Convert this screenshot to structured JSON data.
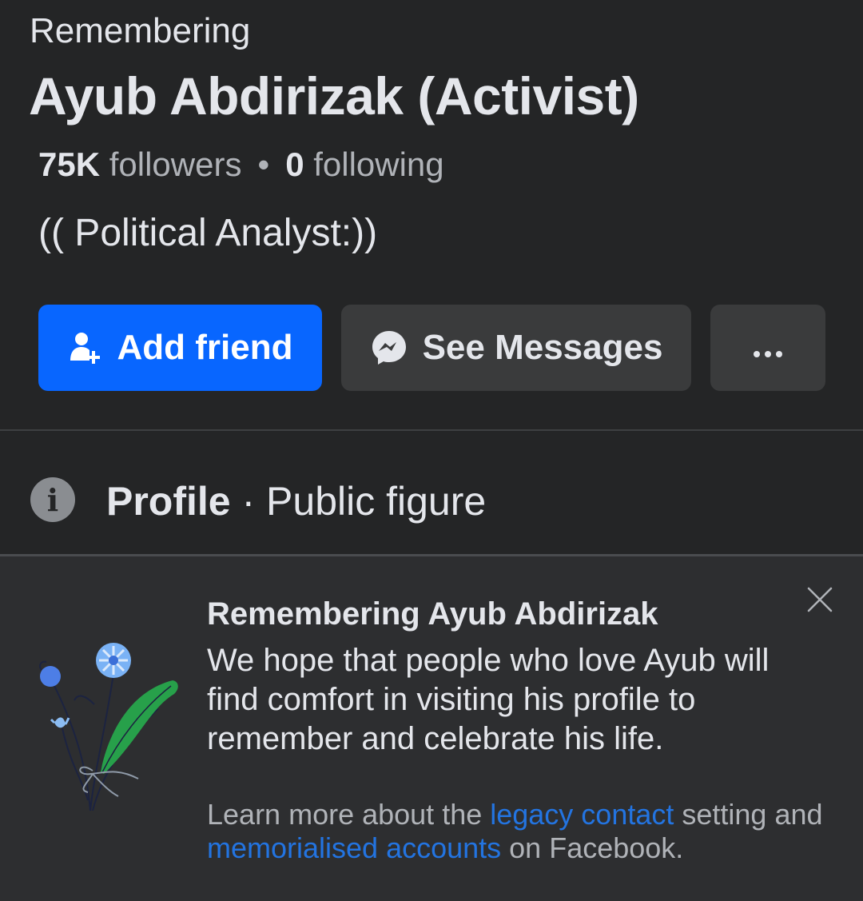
{
  "header": {
    "remembering_label": "Remembering",
    "name": "Ayub Abdirizak (Activist)"
  },
  "stats": {
    "followers_count": "75K",
    "followers_label": "followers",
    "separator": "•",
    "following_count": "0",
    "following_label": "following"
  },
  "bio": "(( Political Analyst:))",
  "actions": {
    "add_friend_label": "Add friend",
    "see_messages_label": "See Messages",
    "more_label": "..."
  },
  "profile_info": {
    "bold_label": "Profile",
    "separator": " · ",
    "category": "Public figure"
  },
  "memorial_card": {
    "title": "Remembering Ayub Abdirizak",
    "body": "We hope that people who love Ayub will find comfort in visiting his profile to remember and celebrate his life.",
    "learn_prefix": "Learn more about the ",
    "legacy_link": "legacy contact",
    "learn_mid": " setting and ",
    "memorial_link": "memorialised accounts",
    "learn_suffix": " on Facebook."
  },
  "icons": {
    "add_friend": "add-person-icon",
    "messenger": "messenger-icon",
    "more": "more-dots-icon",
    "info": "info-icon",
    "close": "close-icon",
    "illustration": "flowers-illustration"
  },
  "colors": {
    "background": "#242526",
    "card_background": "#2d2e30",
    "primary_button": "#0866ff",
    "secondary_button": "#3a3b3c",
    "link": "#2374e1",
    "text_primary": "#e4e6eb",
    "text_secondary": "#b0b3b8"
  }
}
